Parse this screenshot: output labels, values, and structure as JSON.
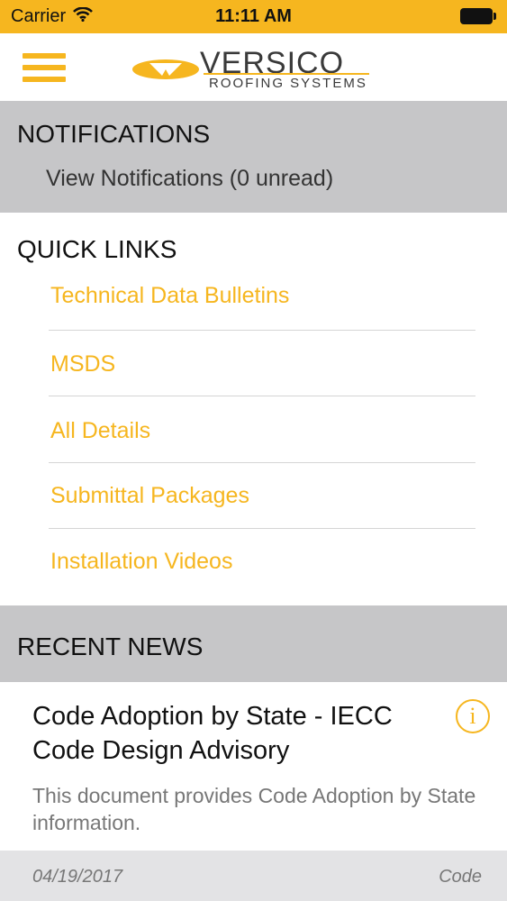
{
  "status_bar": {
    "carrier": "Carrier",
    "time": "11:11 AM"
  },
  "nav": {
    "logo_word": "VERSICO",
    "logo_sub": "ROOFING SYSTEMS"
  },
  "notifications": {
    "title": "NOTIFICATIONS",
    "link": "View Notifications (0 unread)"
  },
  "quick_links": {
    "title": "QUICK LINKS",
    "items": [
      {
        "label": "Technical Data Bulletins"
      },
      {
        "label": "MSDS"
      },
      {
        "label": "All Details"
      },
      {
        "label": "Submittal Packages"
      },
      {
        "label": "Installation Videos"
      }
    ]
  },
  "recent_news": {
    "title": "RECENT NEWS",
    "item": {
      "title": "Code Adoption by State - IECC Code Design Advisory",
      "description": "This document provides Code Adoption by State information.",
      "date": "04/19/2017",
      "category": "Code",
      "info_glyph": "i"
    }
  },
  "colors": {
    "accent": "#f6b61f",
    "section_bg": "#c6c6c8",
    "footer_bg": "#e3e3e5"
  }
}
